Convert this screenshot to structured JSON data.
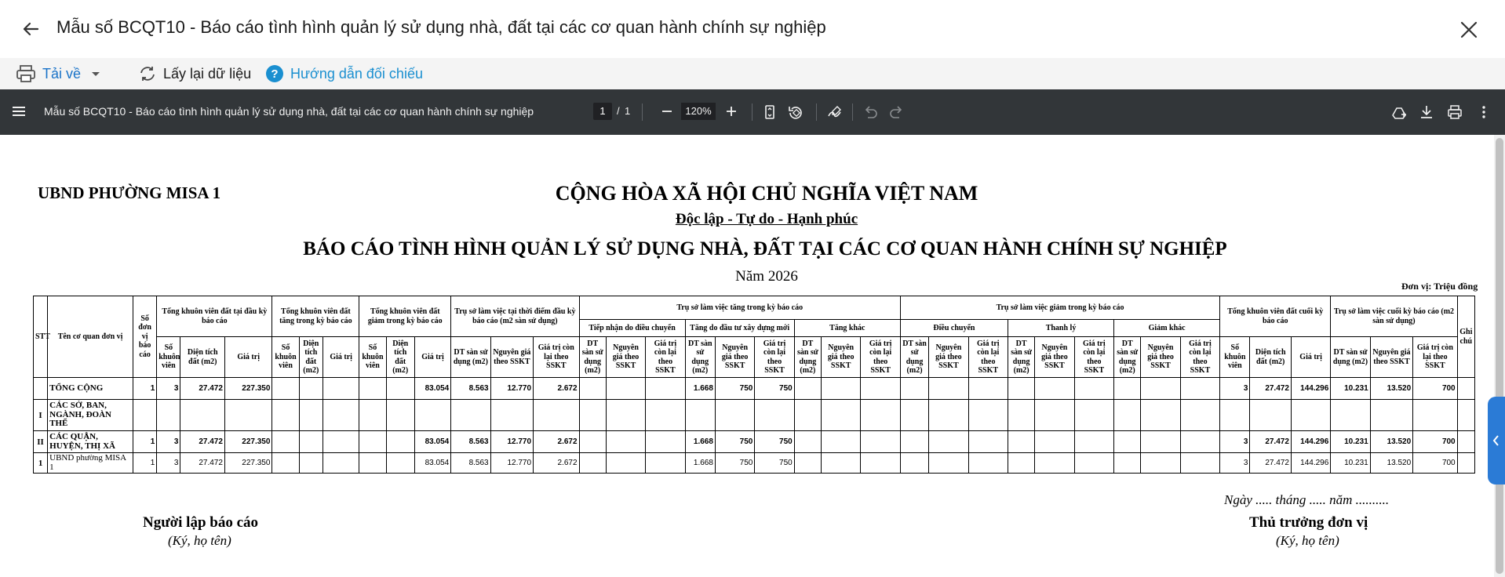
{
  "window": {
    "title": "Mẫu số BCQT10 - Báo cáo tình hình quản lý sử dụng nhà, đất tại các cơ quan hành chính sự nghiệp"
  },
  "toolbar": {
    "download_label": "Tải về",
    "reload_label": "Lấy lại dữ liệu",
    "guide_label": "Hướng dẫn đối chiếu"
  },
  "pdf_viewer": {
    "doc_title": "Mẫu số BCQT10 - Báo cáo tình hình quản lý sử dụng nhà, đất tại các cơ quan hành chính sự nghiệp",
    "current_page": "1",
    "page_separator": "/",
    "total_pages": "1",
    "zoom": "120%"
  },
  "document": {
    "org_name": "UBND PHƯỜNG MISA 1",
    "nation": "CỘNG HÒA XÃ HỘI CHỦ NGHĨA VIỆT NAM",
    "motto": "Độc lập - Tự do - Hạnh phúc",
    "report_title": "BÁO CÁO TÌNH HÌNH QUẢN LÝ SỬ DỤNG NHÀ, ĐẤT TẠI CÁC CƠ QUAN HÀNH CHÍNH SỰ NGHIỆP",
    "year": "Năm 2026",
    "unit": "Đơn vị: Triệu đồng",
    "date_line": "Ngày ..... tháng ..... năm ..........",
    "signer_left_title": "Người lập báo cáo",
    "signer_left_sub": "(Ký, họ tên)",
    "signer_right_title": "Thủ trưởng đơn vị",
    "signer_right_sub": "(Ký, họ tên)"
  },
  "table": {
    "headers": {
      "stt": "STT",
      "name": "Tên cơ quan đơn vị",
      "units": "Số đơn vị báo cáo",
      "g_begin": "Tổng khuôn viên đất tại đầu kỳ báo cáo",
      "g_inc": "Tổng khuôn viên đất tăng trong kỳ báo cáo",
      "g_dec": "Tổng khuôn viên đất giảm trong kỳ báo cáo",
      "g_hq_begin": "Trụ sở làm việc tại thời điểm đầu kỳ báo cáo (m2 sàn sử dụng)",
      "g_hq_inc": "Trụ sở làm việc tăng trong kỳ báo cáo",
      "g_hq_dec": "Trụ sở làm việc giảm trong kỳ báo cáo",
      "g_end": "Tổng khuôn viên đất cuối kỳ báo cáo",
      "g_hq_end": "Trụ sở làm việc cuối kỳ báo cáo (m2 sàn sử dụng)",
      "note": "Ghi chú",
      "sub_receive": "Tiếp nhận do điều chuyển",
      "sub_build": "Tăng do đầu tư xây dựng mới",
      "sub_other_inc": "Tăng khác",
      "sub_transfer": "Điều chuyển",
      "sub_liquidate": "Thanh lý",
      "sub_other_dec": "Giảm khác",
      "c_count": "Số khuôn viên",
      "c_area": "Diện tích đất (m2)",
      "c_value": "Giá trị",
      "c_floor": "DT sàn sử dụng (m2)",
      "c_orig": "Nguyên giá theo SSKT",
      "c_remain": "Giá trị còn lại theo SSKT"
    },
    "rows": [
      {
        "stt": "",
        "name": "TỔNG CỘNG",
        "units": "1",
        "b_count": "3",
        "b_area": "27.472",
        "b_value": "227.350",
        "i_count": "",
        "i_area": "",
        "i_value": "",
        "d_count": "",
        "d_area": "",
        "d_value": "83.054",
        "hb_floor": "8.563",
        "hb_orig": "12.770",
        "hb_remain": "2.672",
        "r_floor": "",
        "r_orig": "",
        "r_remain": "",
        "n_floor": "1.668",
        "n_orig": "750",
        "n_remain": "750",
        "o_floor": "",
        "o_orig": "",
        "o_remain": "",
        "t_floor": "",
        "t_orig": "",
        "t_remain": "",
        "l_floor": "",
        "l_orig": "",
        "l_remain": "",
        "g_floor": "",
        "g_orig": "",
        "g_remain": "",
        "e_count": "3",
        "e_area": "27.472",
        "e_value": "144.296",
        "he_floor": "10.231",
        "he_orig": "13.520",
        "he_remain": "700",
        "note": ""
      },
      {
        "stt": "I",
        "name": "CÁC SỞ, BAN, NGÀNH, ĐOÀN THỂ",
        "units": "",
        "b_count": "",
        "b_area": "",
        "b_value": "",
        "i_count": "",
        "i_area": "",
        "i_value": "",
        "d_count": "",
        "d_area": "",
        "d_value": "",
        "hb_floor": "",
        "hb_orig": "",
        "hb_remain": "",
        "r_floor": "",
        "r_orig": "",
        "r_remain": "",
        "n_floor": "",
        "n_orig": "",
        "n_remain": "",
        "o_floor": "",
        "o_orig": "",
        "o_remain": "",
        "t_floor": "",
        "t_orig": "",
        "t_remain": "",
        "l_floor": "",
        "l_orig": "",
        "l_remain": "",
        "g_floor": "",
        "g_orig": "",
        "g_remain": "",
        "e_count": "",
        "e_area": "",
        "e_value": "",
        "he_floor": "",
        "he_orig": "",
        "he_remain": "",
        "note": ""
      },
      {
        "stt": "II",
        "name": "CÁC QUẬN, HUYỆN, THỊ XÃ",
        "units": "1",
        "b_count": "3",
        "b_area": "27.472",
        "b_value": "227.350",
        "i_count": "",
        "i_area": "",
        "i_value": "",
        "d_count": "",
        "d_area": "",
        "d_value": "83.054",
        "hb_floor": "8.563",
        "hb_orig": "12.770",
        "hb_remain": "2.672",
        "r_floor": "",
        "r_orig": "",
        "r_remain": "",
        "n_floor": "1.668",
        "n_orig": "750",
        "n_remain": "750",
        "o_floor": "",
        "o_orig": "",
        "o_remain": "",
        "t_floor": "",
        "t_orig": "",
        "t_remain": "",
        "l_floor": "",
        "l_orig": "",
        "l_remain": "",
        "g_floor": "",
        "g_orig": "",
        "g_remain": "",
        "e_count": "3",
        "e_area": "27.472",
        "e_value": "144.296",
        "he_floor": "10.231",
        "he_orig": "13.520",
        "he_remain": "700",
        "note": ""
      },
      {
        "stt": "1",
        "name": "UBND phường MISA 1",
        "units": "1",
        "b_count": "3",
        "b_area": "27.472",
        "b_value": "227.350",
        "i_count": "",
        "i_area": "",
        "i_value": "",
        "d_count": "",
        "d_area": "",
        "d_value": "83.054",
        "hb_floor": "8.563",
        "hb_orig": "12.770",
        "hb_remain": "2.672",
        "r_floor": "",
        "r_orig": "",
        "r_remain": "",
        "n_floor": "1.668",
        "n_orig": "750",
        "n_remain": "750",
        "o_floor": "",
        "o_orig": "",
        "o_remain": "",
        "t_floor": "",
        "t_orig": "",
        "t_remain": "",
        "l_floor": "",
        "l_orig": "",
        "l_remain": "",
        "g_floor": "",
        "g_orig": "",
        "g_remain": "",
        "e_count": "3",
        "e_area": "27.472",
        "e_value": "144.296",
        "he_floor": "10.231",
        "he_orig": "13.520",
        "he_remain": "700",
        "note": ""
      }
    ]
  }
}
